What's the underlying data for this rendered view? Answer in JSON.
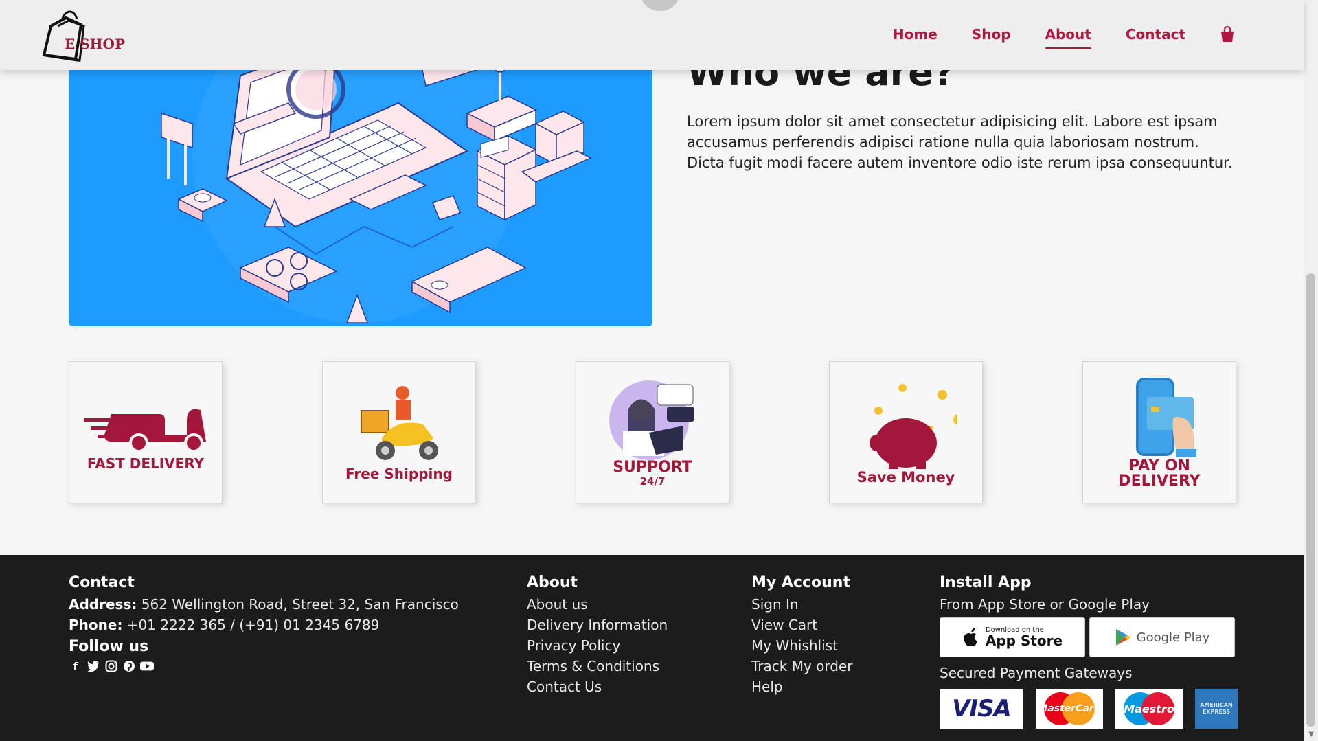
{
  "header": {
    "logo_text": "E SHOP",
    "nav": [
      {
        "label": "Home"
      },
      {
        "label": "Shop"
      },
      {
        "label": "About",
        "active": true
      },
      {
        "label": "Contact"
      }
    ]
  },
  "about": {
    "title": "Who we are?",
    "text": "Lorem ipsum dolor sit amet consectetur adipisicing elit. Labore est ipsam accusamus perferendis adipisci ratione nulla quia laboriosam nostrum. Dicta fugit modi facere autem inventore odio iste rerum ipsa consequuntur."
  },
  "features": [
    {
      "label": "FAST DELIVERY"
    },
    {
      "label": "Free Shipping"
    },
    {
      "label": "SUPPORT",
      "sub": "24/7"
    },
    {
      "label": "Save Money"
    },
    {
      "label": "PAY ON DELIVERY"
    }
  ],
  "footer": {
    "contact": {
      "heading": "Contact",
      "address_label": "Address:",
      "address": "562 Wellington Road, Street 32, San Francisco",
      "phone_label": "Phone:",
      "phone": "+01 2222 365 / (+91) 01 2345 6789",
      "follow": "Follow us"
    },
    "about": {
      "heading": "About",
      "links": [
        "About us",
        "Delivery Information",
        "Privacy Policy",
        "Terms & Conditions",
        "Contact Us"
      ]
    },
    "account": {
      "heading": "My Account",
      "links": [
        "Sign In",
        "View Cart",
        "My Whishlist",
        "Track My order",
        "Help"
      ]
    },
    "app": {
      "heading": "Install App",
      "subtitle": "From App Store or Google Play",
      "appstore_small": "Download on the",
      "appstore_big": "App Store",
      "googleplay": "Google Play",
      "payments_title": "Secured Payment Gateways",
      "payments": [
        "VISA",
        "MasterCard",
        "Maestro",
        "AMERICAN EXPRESS"
      ]
    }
  },
  "colors": {
    "brand": "#b0183f",
    "hero_bg": "#1e9bff",
    "footer_bg": "#1c1c1c"
  }
}
